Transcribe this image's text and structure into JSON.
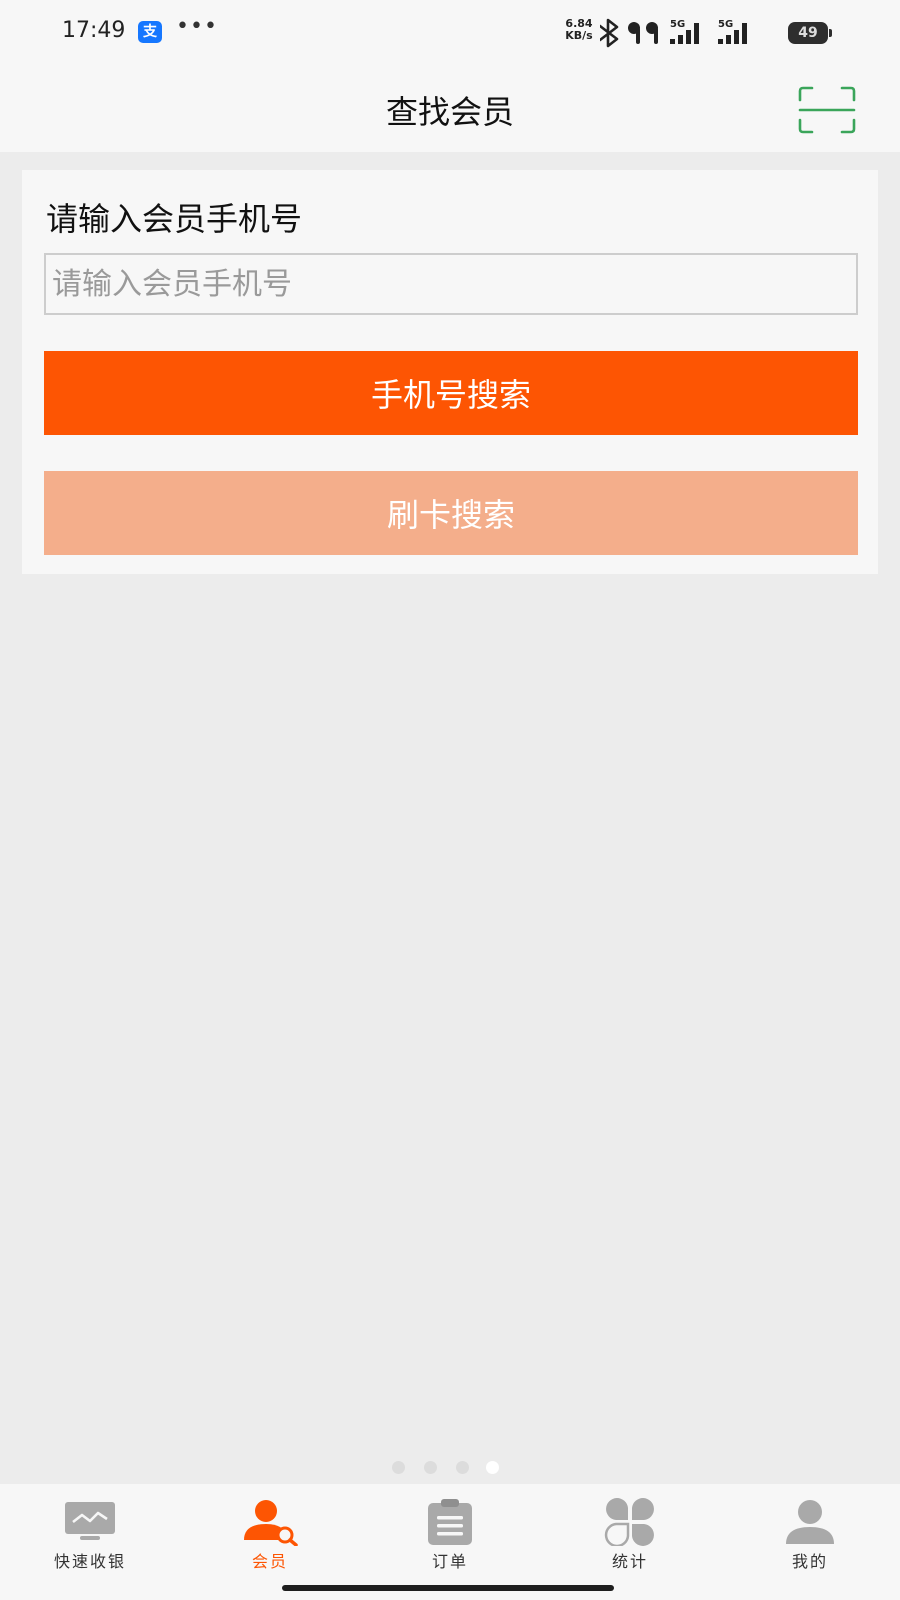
{
  "status_bar": {
    "time": "17:49",
    "alipay_glyph": "支",
    "more": "•••",
    "net_speed_value": "6.84",
    "net_speed_unit": "KB/s",
    "signal_1": "5G",
    "signal_2": "5G",
    "battery": "49"
  },
  "header": {
    "title": "查找会员",
    "scan_icon": "scan-icon",
    "accent_color": "#3aa55a"
  },
  "search": {
    "label": "请输入会员手机号",
    "input_value": "",
    "input_placeholder": "请输入会员手机号",
    "phone_search_label": "手机号搜索",
    "card_search_label": "刷卡搜索"
  },
  "colors": {
    "primary": "#fd5503",
    "primary_light": "#f4ae8b",
    "tab_inactive": "#a9a9a9"
  },
  "pager": {
    "count": 4,
    "active_index": 3
  },
  "tabs": [
    {
      "label": "快速收银",
      "icon": "monitor-chart-icon",
      "active": false
    },
    {
      "label": "会员",
      "icon": "member-search-icon",
      "active": true
    },
    {
      "label": "订单",
      "icon": "clipboard-icon",
      "active": false
    },
    {
      "label": "统计",
      "icon": "grid-petals-icon",
      "active": false
    },
    {
      "label": "我的",
      "icon": "user-icon",
      "active": false
    }
  ]
}
